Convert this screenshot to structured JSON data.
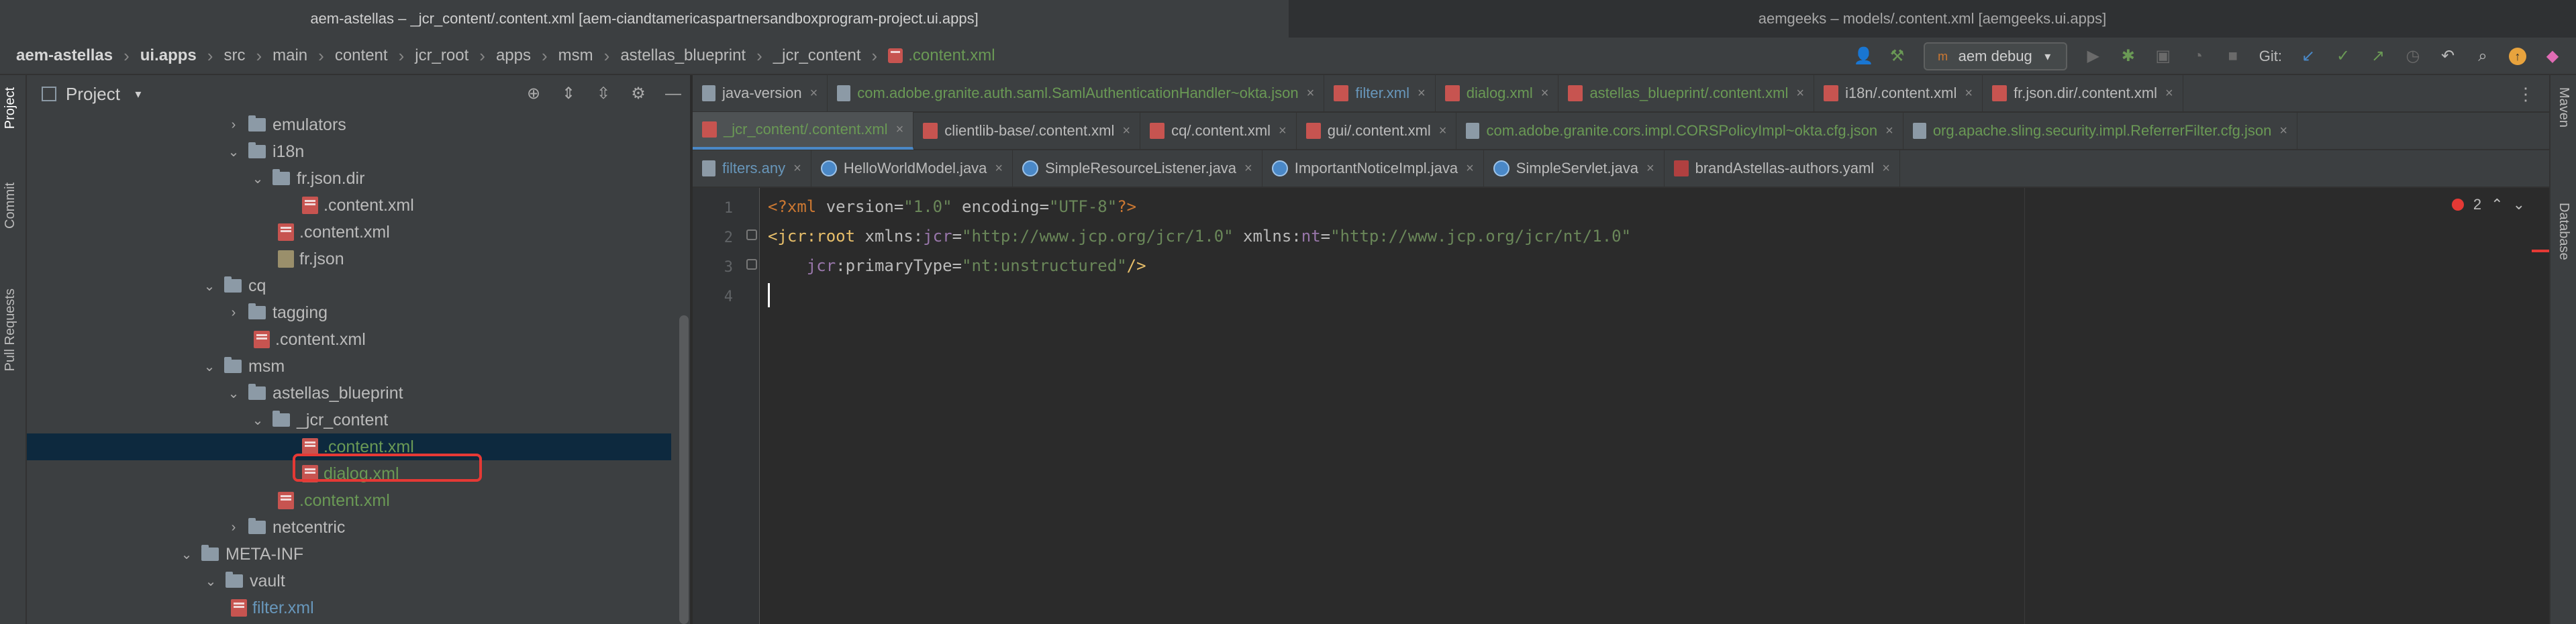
{
  "window": {
    "title_left": "aem-astellas – _jcr_content/.content.xml [aem-ciandtamericaspartnersandboxprogram-project.ui.apps]",
    "title_right": "aemgeeks – models/.content.xml [aemgeeks.ui.apps]"
  },
  "breadcrumb": [
    "aem-astellas",
    "ui.apps",
    "src",
    "main",
    "content",
    "jcr_root",
    "apps",
    "msm",
    "astellas_blueprint",
    "_jcr_content",
    ".content.xml"
  ],
  "toolbar": {
    "run_config": "aem debug",
    "git_label": "Git:"
  },
  "left_strip": {
    "project": "Project",
    "commit": "Commit",
    "pull_requests": "Pull Requests"
  },
  "right_strip": {
    "maven": "Maven",
    "database": "Database"
  },
  "project_panel": {
    "title": "Project",
    "tree": [
      {
        "label": "emulators",
        "type": "folder",
        "arrow": "›"
      },
      {
        "label": "i18n",
        "type": "folder",
        "arrow": "⌄"
      },
      {
        "label": "fr.json.dir",
        "type": "folder",
        "arrow": "⌄"
      },
      {
        "label": ".content.xml",
        "type": "xml"
      },
      {
        "label": ".content.xml",
        "type": "xml"
      },
      {
        "label": "fr.json",
        "type": "json"
      },
      {
        "label": "cq",
        "type": "folder",
        "arrow": "⌄"
      },
      {
        "label": "tagging",
        "type": "folder",
        "arrow": "›"
      },
      {
        "label": ".content.xml",
        "type": "xml"
      },
      {
        "label": "msm",
        "type": "folder",
        "arrow": "⌄"
      },
      {
        "label": "astellas_blueprint",
        "type": "folder",
        "arrow": "⌄"
      },
      {
        "label": "_jcr_content",
        "type": "folder",
        "arrow": "⌄"
      },
      {
        "label": ".content.xml",
        "type": "xml"
      },
      {
        "label": "dialog.xml",
        "type": "xml"
      },
      {
        "label": ".content.xml",
        "type": "xml"
      },
      {
        "label": "netcentric",
        "type": "folder",
        "arrow": "›"
      },
      {
        "label": "META-INF",
        "type": "folder",
        "arrow": "⌄"
      },
      {
        "label": "vault",
        "type": "folder",
        "arrow": "⌄"
      },
      {
        "label": "filter.xml",
        "type": "xml"
      }
    ]
  },
  "tabs": {
    "row1": [
      "java-version",
      "com.adobe.granite.auth.saml.SamlAuthenticationHandler~okta.json",
      "filter.xml",
      "dialog.xml",
      "astellas_blueprint/.content.xml",
      "i18n/.content.xml",
      "fr.json.dir/.content.xml"
    ],
    "row2": [
      "_jcr_content/.content.xml",
      "clientlib-base/.content.xml",
      "cq/.content.xml",
      "gui/.content.xml",
      "com.adobe.granite.cors.impl.CORSPolicyImpl~okta.cfg.json",
      "org.apache.sling.security.impl.ReferrerFilter.cfg.json"
    ],
    "row3": [
      "filters.any",
      "HelloWorldModel.java",
      "SimpleResourceListener.java",
      "ImportantNoticeImpl.java",
      "SimpleServlet.java",
      "brandAstellas-authors.yaml"
    ]
  },
  "editor": {
    "line_numbers": [
      "1",
      "2",
      "3",
      "4"
    ],
    "line1": {
      "a": "<?xml ",
      "b": "version=",
      "c": "\"1.0\"",
      "d": " encoding=",
      "e": "\"UTF-8\"",
      "f": "?>"
    },
    "line2": {
      "a": "<jcr:root ",
      "b": "xmlns:",
      "c": "jcr",
      "d": "=",
      "e": "\"http://www.jcp.org/jcr/1.0\"",
      "f": " xmlns:",
      "g": "nt",
      "h": "=",
      "i": "\"http://www.jcp.org/jcr/nt/1.0\""
    },
    "line3": {
      "a": "    ",
      "b": "jcr",
      "c": ":primaryType=",
      "d": "\"nt:unstructured\"",
      "e": "/>"
    },
    "error_count": "2"
  }
}
